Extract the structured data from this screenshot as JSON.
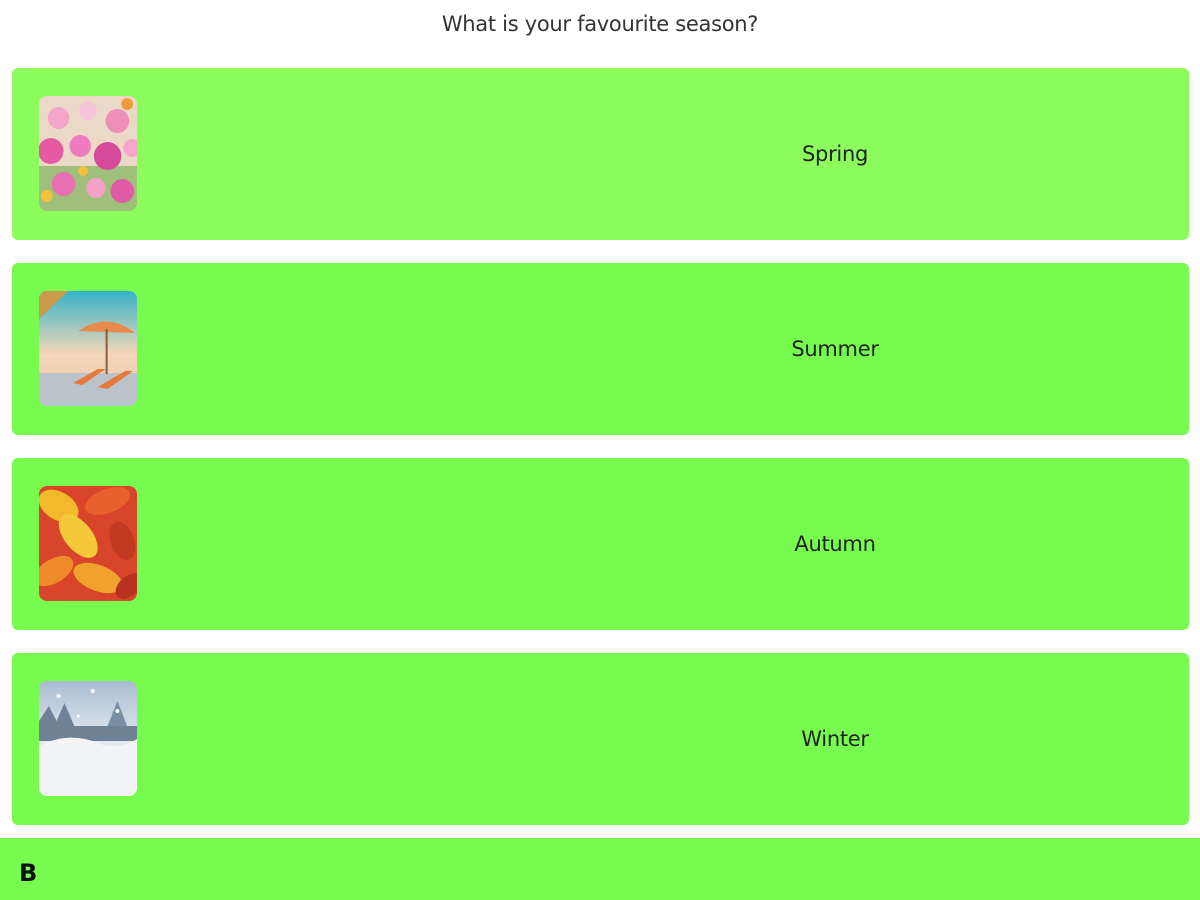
{
  "question": "What is your favourite season?",
  "options": [
    {
      "label": "Spring",
      "image": "spring-flowers-image",
      "bg": "#8cfd5c"
    },
    {
      "label": "Summer",
      "image": "summer-beach-image",
      "bg": "#78fb4f"
    },
    {
      "label": "Autumn",
      "image": "autumn-leaves-image",
      "bg": "#78fb4f"
    },
    {
      "label": "Winter",
      "image": "winter-snow-image",
      "bg": "#78fb4f"
    }
  ],
  "footer": {
    "key": "B",
    "bg": "#78fb4f"
  }
}
